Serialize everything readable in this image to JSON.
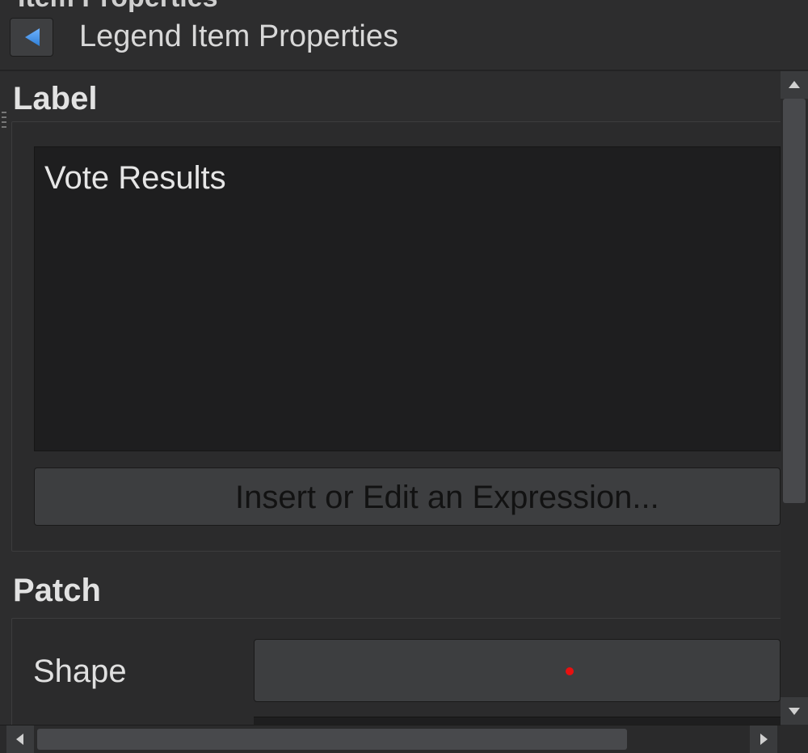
{
  "header": {
    "cut_title": "Item Properties",
    "panel_title": "Legend Item Properties",
    "back_icon": "triangle-left-icon"
  },
  "label_section": {
    "title": "Label",
    "text_value": "Vote Results",
    "expression_button": "Insert or Edit an Expression..."
  },
  "patch_section": {
    "title": "Patch",
    "shape_label": "Shape",
    "shape_marker_color": "#e81010"
  },
  "colors": {
    "background": "#2d2d2e",
    "accent": "#3b8fe0"
  }
}
